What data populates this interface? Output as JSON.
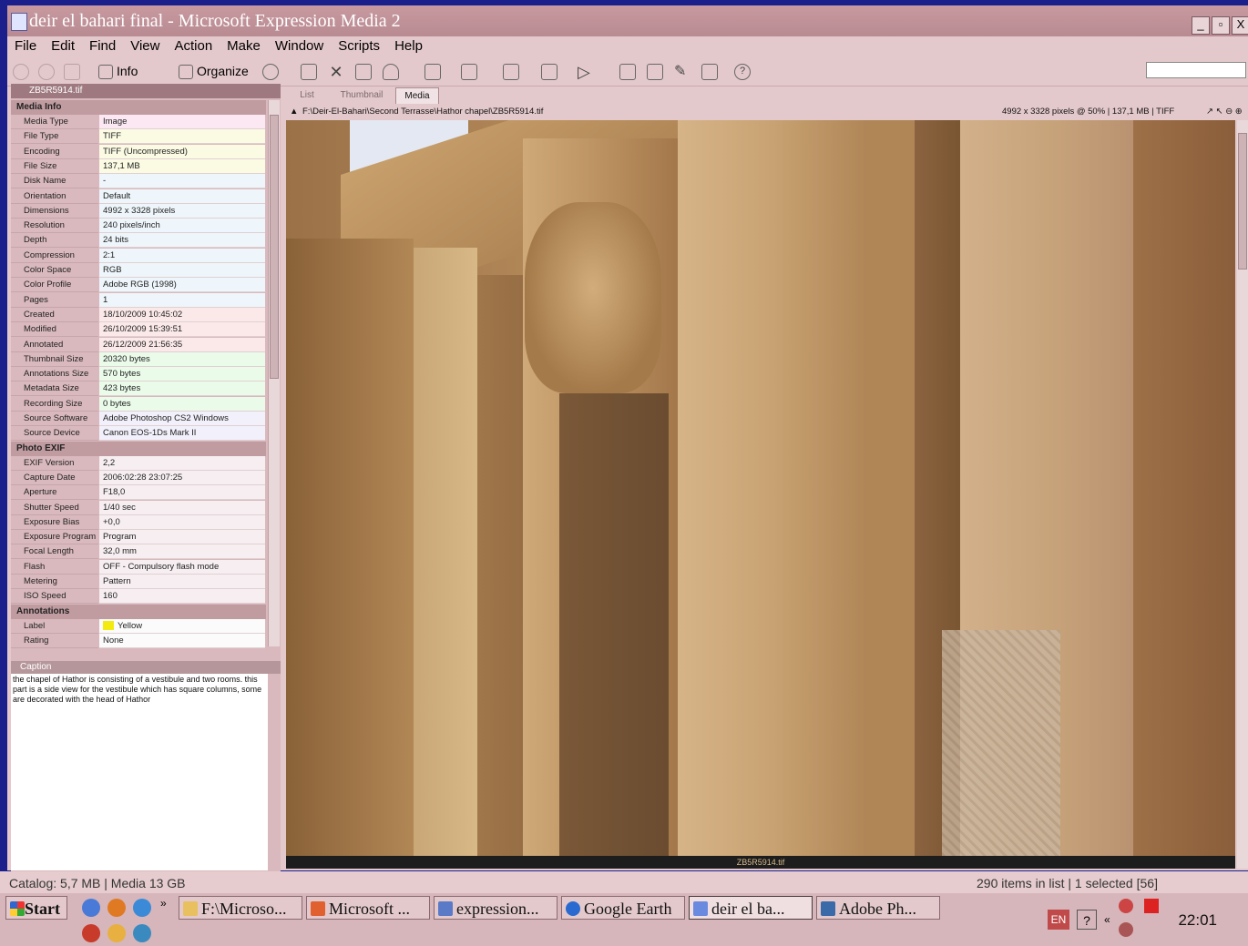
{
  "window": {
    "title": "deir el bahari final - Microsoft Expression Media 2",
    "buttons": [
      "_",
      "▫",
      "X"
    ]
  },
  "menu": [
    "File",
    "Edit",
    "Find",
    "View",
    "Action",
    "Make",
    "Window",
    "Scripts",
    "Help"
  ],
  "toolbar": {
    "info_label": "Info",
    "organize_label": "Organize"
  },
  "left_panel": {
    "header_file": "ZB5R5914.tif",
    "sections": [
      {
        "title": "Media Info",
        "rows": [
          {
            "k": "Media Type",
            "v": "Image"
          },
          {
            "k": "File Type",
            "v": "TIFF"
          },
          {
            "k": "Encoding",
            "v": "TIFF (Uncompressed)"
          },
          {
            "k": "File Size",
            "v": "137,1 MB"
          },
          {
            "k": "Disk Name",
            "v": "-"
          },
          {
            "k": "Orientation",
            "v": "Default"
          },
          {
            "k": "Dimensions",
            "v": "4992 x 3328 pixels"
          },
          {
            "k": "Resolution",
            "v": "240 pixels/inch"
          },
          {
            "k": "Depth",
            "v": "24 bits"
          },
          {
            "k": "Compression",
            "v": "2:1"
          },
          {
            "k": "Color Space",
            "v": "RGB"
          },
          {
            "k": "Color Profile",
            "v": "Adobe RGB (1998)"
          },
          {
            "k": "Pages",
            "v": "1"
          },
          {
            "k": "Created",
            "v": "18/10/2009 10:45:02"
          },
          {
            "k": "Modified",
            "v": "26/10/2009 15:39:51"
          },
          {
            "k": "Annotated",
            "v": "26/12/2009 21:56:35"
          },
          {
            "k": "Thumbnail Size",
            "v": "20320 bytes"
          },
          {
            "k": "Annotations Size",
            "v": "570 bytes"
          },
          {
            "k": "Metadata Size",
            "v": "423 bytes"
          },
          {
            "k": "Recording Size",
            "v": "0 bytes"
          },
          {
            "k": "Source Software",
            "v": "Adobe Photoshop CS2 Windows"
          },
          {
            "k": "Source Device",
            "v": "Canon EOS-1Ds Mark II"
          }
        ]
      },
      {
        "title": "Photo EXIF",
        "rows": [
          {
            "k": "EXIF Version",
            "v": "2,2"
          },
          {
            "k": "Capture Date",
            "v": "2006:02:28 23:07:25"
          },
          {
            "k": "Aperture",
            "v": "F18,0"
          },
          {
            "k": "Shutter Speed",
            "v": "1/40 sec"
          },
          {
            "k": "Exposure Bias",
            "v": "+0,0"
          },
          {
            "k": "Exposure Program",
            "v": "Program"
          },
          {
            "k": "Focal Length",
            "v": "32,0 mm"
          },
          {
            "k": "Flash",
            "v": "OFF - Compulsory flash mode"
          },
          {
            "k": "Metering",
            "v": "Pattern"
          },
          {
            "k": "ISO Speed",
            "v": "160"
          }
        ]
      },
      {
        "title": "Annotations",
        "rows": [
          {
            "k": "Label",
            "v": "Yellow"
          },
          {
            "k": "Rating",
            "v": "None"
          }
        ]
      }
    ],
    "caption_title": "Caption",
    "caption_text": "the chapel of Hathor is consisting of a vestibule and two rooms. this part is a side view for the vestibule which has square columns, some are decorated with the head of Hathor"
  },
  "colors": {
    "row_colors": [
      "#fbe8f3",
      "#fbfbe4",
      "#fbfbe4",
      "#fbfbe4",
      "#eef6fb",
      "#eef6fb",
      "#eef6fb",
      "#eef6fb",
      "#eef6fb",
      "#eef6fb",
      "#eef6fb",
      "#eef6fb",
      "#eef6fb",
      "#fbe9e9",
      "#fbe9e9",
      "#fbe9e9",
      "#eafbea",
      "#eafbea",
      "#eafbea",
      "#eafbea",
      "#f2f0fb",
      "#f2f0fb"
    ],
    "label_yellow": "#f2ea10"
  },
  "tabs": [
    "List",
    "Thumbnail",
    "Media"
  ],
  "active_tab": "Media",
  "viewer": {
    "path": "F:\\Deir-El-Bahari\\Second Terrasse\\Hathor chapel\\ZB5R5914.tif",
    "info": "4992 x 3328 pixels @ 50%  |  137,1 MB  |  TIFF",
    "filename": "ZB5R5914.tif"
  },
  "statusbar": {
    "catalog": "Catalog: 5,7 MB  |  Media 13 GB",
    "items": "290 items in list  |  1 selected [56]"
  },
  "taskbar": {
    "start": "Start",
    "tasks": [
      "F:\\Microso...",
      "Microsoft ...",
      "expression...",
      "Google Earth",
      "deir el ba...",
      "Adobe Ph..."
    ],
    "active_task": 4,
    "lang": "EN",
    "clock": "22:01"
  }
}
